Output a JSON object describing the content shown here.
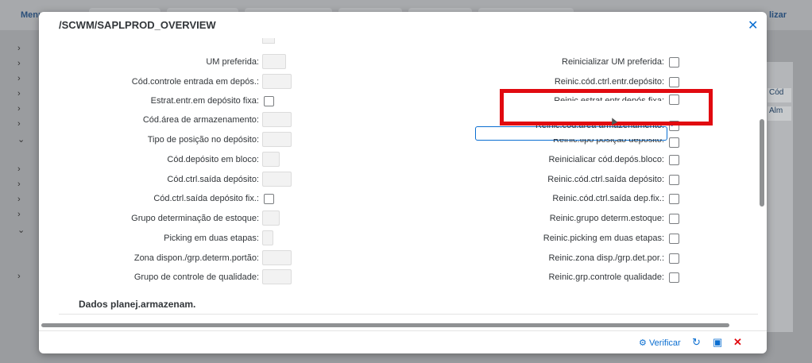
{
  "background": {
    "top_left_label": "Menu",
    "top_right_label": "lizar",
    "right_col_header": "Cód",
    "right_col_value": "Alm"
  },
  "dialog": {
    "title": "/SCWM/SAPLPROD_OVERVIEW",
    "close_icon": "close-icon"
  },
  "fields_left": [
    {
      "label": "UM preferida:",
      "type": "input",
      "width": "narrow"
    },
    {
      "label": "Cód.controle entrada em depós.:",
      "type": "input",
      "width": "wide"
    },
    {
      "label": "Estrat.entr.em depósito fixa:",
      "type": "checkbox",
      "checked": false
    },
    {
      "label": "Cód.área de armazenamento:",
      "type": "input",
      "width": "wide"
    },
    {
      "label": "Tipo de posição no depósito:",
      "type": "input",
      "width": "wide"
    },
    {
      "label": "Cód.depósito em bloco:",
      "type": "input",
      "width": "narrow"
    },
    {
      "label": "Cód.ctrl.saída depósito:",
      "type": "input",
      "width": "wide"
    },
    {
      "label": "Cód.ctrl.saída depósito fix.:",
      "type": "checkbox",
      "checked": false
    },
    {
      "label": "Grupo determinação de estoque:",
      "type": "input",
      "width": "narrow"
    },
    {
      "label": "Picking em duas etapas:",
      "type": "input",
      "width": "small"
    },
    {
      "label": "Zona dispon./grp.determ.portão:",
      "type": "input",
      "width": "wide"
    },
    {
      "label": "Grupo de controle de qualidade:",
      "type": "input",
      "width": "wide"
    }
  ],
  "fields_right": [
    {
      "label": "Reinicializar UM preferida:",
      "checked": false
    },
    {
      "label": "Reinic.cód.ctrl.entr.depósito:",
      "checked": false
    },
    {
      "label": "Reinic.estrat.entr.depós.fixa:",
      "checked": false
    },
    {
      "label": "Reinic.cód.área armazenamento:",
      "checked": true
    },
    {
      "label": "Reinic.tipo posição depósito:",
      "checked": false
    },
    {
      "label": "Reinicialicar cód.depós.bloco:",
      "checked": false
    },
    {
      "label": "Reinic.cód.ctrl.saída depósito:",
      "checked": false
    },
    {
      "label": "Reinic.cód.ctrl.saída dep.fix.:",
      "checked": false
    },
    {
      "label": "Reinic.grupo determ.estoque:",
      "checked": false
    },
    {
      "label": "Reinic.picking em duas etapas:",
      "checked": false
    },
    {
      "label": "Reinic.zona disp./grp.det.por.:",
      "checked": false
    },
    {
      "label": "Reinic.grp.controle qualidade:",
      "checked": false
    }
  ],
  "section": {
    "title": "Dados planej.armazenam."
  },
  "footer": {
    "verificar_label": "Verificar",
    "icons": [
      "check-icon",
      "refresh-icon",
      "save-icon",
      "cancel-icon"
    ]
  },
  "colors": {
    "accent": "#0a6ed1",
    "highlight": "#e10a10"
  }
}
